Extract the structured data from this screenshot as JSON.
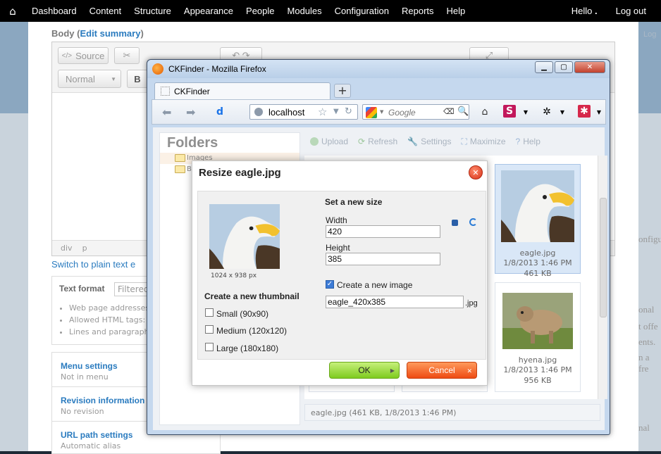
{
  "toolbar": {
    "home": "⌂",
    "items": [
      "Dashboard",
      "Content",
      "Structure",
      "Appearance",
      "People",
      "Modules",
      "Configuration",
      "Reports",
      "Help"
    ],
    "hello": "Hello",
    "logout": "Log out"
  },
  "editor": {
    "body_label": "Body",
    "edit_summary": "Edit summary",
    "source": "Source",
    "format": "Normal",
    "bold": "B",
    "path": [
      "div",
      "p"
    ],
    "switch_link": "Switch to plain text e",
    "text_format_label": "Text format",
    "text_format_value": "Filtered",
    "tips": [
      "Web page addresses",
      "Allowed HTML tags:",
      "Lines and paragraph"
    ],
    "vertical_tabs": [
      {
        "title": "Menu settings",
        "summary": "Not in menu"
      },
      {
        "title": "Revision information",
        "summary": "No revision"
      },
      {
        "title": "URL path settings",
        "summary": "Automatic alias"
      }
    ],
    "right_fragments": [
      "Log",
      "onfigu",
      "onal",
      "t offe",
      "ents.",
      "n a fre",
      "nal"
    ]
  },
  "firefox": {
    "title": "CKFinder - Mozilla Firefox",
    "tab": "CKFinder",
    "url": "localhost",
    "search_placeholder": "Google"
  },
  "ckfinder": {
    "folders_title": "Folders",
    "folders": [
      "Images",
      "B"
    ],
    "toolbar": [
      "Upload",
      "Refresh",
      "Settings",
      "Maximize",
      "Help"
    ],
    "files": [
      {
        "name": "eagle.jpg",
        "date": "1/8/2013 1:46 PM",
        "size": "461 KB",
        "selected": true
      },
      {
        "name": "hyena.jpg",
        "date": "1/8/2013 1:46 PM",
        "size": "956 KB",
        "selected": false
      }
    ],
    "status": "eagle.jpg (461 KB, 1/8/2013 1:46 PM)"
  },
  "dialog": {
    "title": "Resize eagle.jpg",
    "image_dims": "1024 x 938 px",
    "new_size_title": "Set a new size",
    "width_label": "Width",
    "width_value": "420",
    "height_label": "Height",
    "height_value": "385",
    "create_new_image_label": "Create a new image",
    "create_new_image_checked": true,
    "new_filename": "eagle_420x385",
    "extension": ".jpg",
    "thumbnail_title": "Create a new thumbnail",
    "thumbnails": [
      {
        "label": "Small (90x90)",
        "checked": false
      },
      {
        "label": "Medium (120x120)",
        "checked": false
      },
      {
        "label": "Large (180x180)",
        "checked": false
      }
    ],
    "ok": "OK",
    "cancel": "Cancel"
  }
}
